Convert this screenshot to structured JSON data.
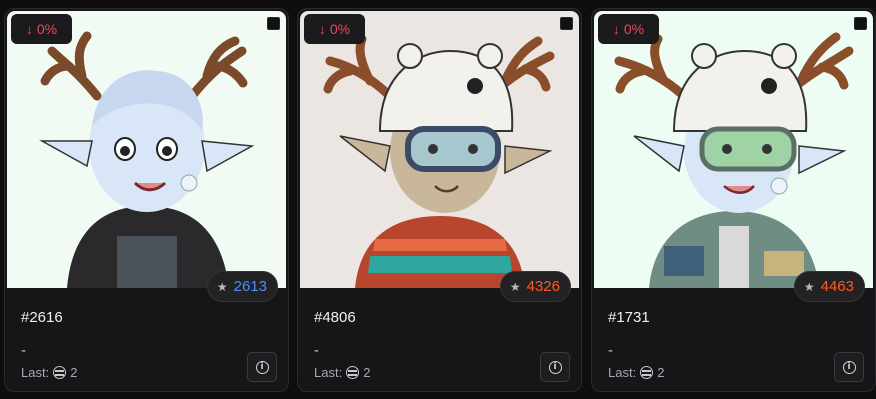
{
  "colors": {
    "page_bg": "#0e0e0f",
    "card_bg": "#161618",
    "change_negative": "#f0455a",
    "rank_blue": "#4c8ff5",
    "rank_orange": "#ff5a1f"
  },
  "cards": [
    {
      "change": "0%",
      "change_icon": "arrow-down-icon",
      "rank": "2613",
      "rank_color": "blue",
      "token_id": "#2616",
      "price": "-",
      "last_label": "Last:",
      "last_value": "2",
      "currency_icon": "eth-icon",
      "info_icon": "info-icon"
    },
    {
      "change": "0%",
      "change_icon": "arrow-down-icon",
      "rank": "4326",
      "rank_color": "orange",
      "token_id": "#4806",
      "price": "-",
      "last_label": "Last:",
      "last_value": "2",
      "currency_icon": "eth-icon",
      "info_icon": "info-icon"
    },
    {
      "change": "0%",
      "change_icon": "arrow-down-icon",
      "rank": "4463",
      "rank_color": "orange",
      "token_id": "#1731",
      "price": "-",
      "last_label": "Last:",
      "last_value": "2",
      "currency_icon": "eth-icon",
      "info_icon": "info-icon"
    }
  ]
}
